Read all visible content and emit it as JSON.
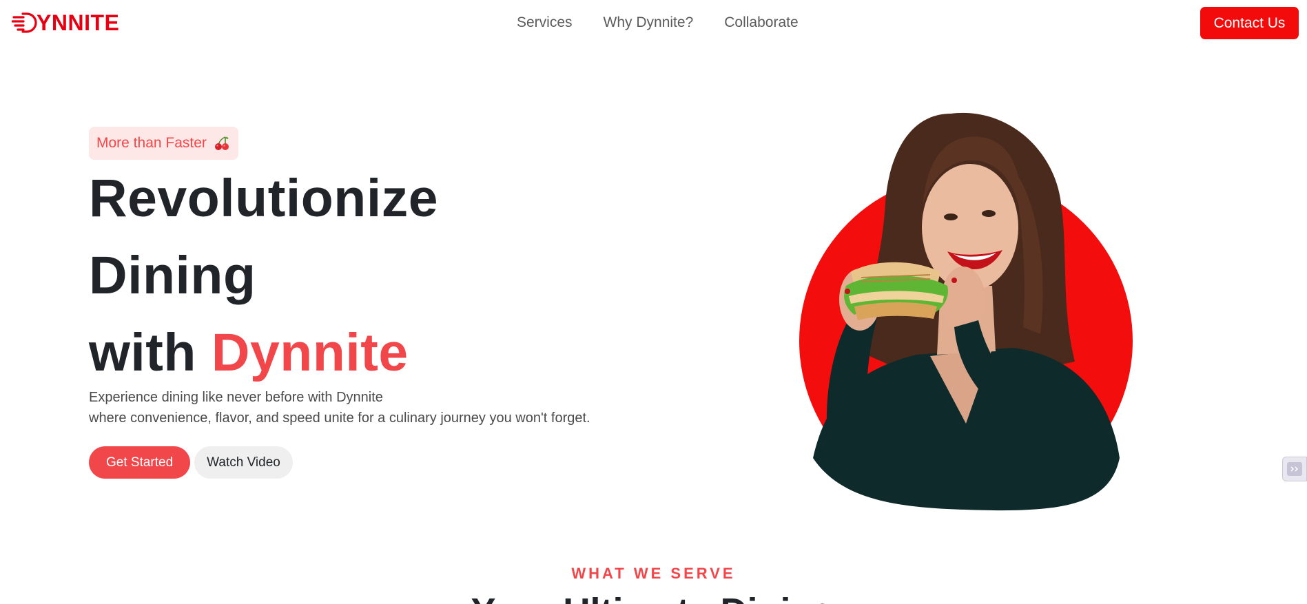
{
  "brand": {
    "logo_text": "YNNITE",
    "logo_color": "#e60012"
  },
  "nav": {
    "links": [
      {
        "label": "Services"
      },
      {
        "label": "Why Dynnite?"
      },
      {
        "label": "Collaborate"
      }
    ],
    "contact_label": "Contact Us"
  },
  "hero": {
    "badge_text": "More than Faster",
    "badge_icon": "cherry-icon",
    "title_line1": "Revolutionize",
    "title_line2": "Dining",
    "title_line3_prefix": "with",
    "title_line3_accent": "Dynnite",
    "desc_line1": "Experience dining like never before with Dynnite",
    "desc_line2": "where convenience, flavor, and speed unite for a culinary journey you won't forget.",
    "primary_button": "Get Started",
    "secondary_button": "Watch Video",
    "image_alt": "woman eating a sandwich"
  },
  "section": {
    "eyebrow": "WHAT WE SERVE",
    "title": "Your Ultimate Dining"
  },
  "colors": {
    "accent": "#f1474a",
    "brand_red": "#f30a0a",
    "heading": "#212529"
  }
}
